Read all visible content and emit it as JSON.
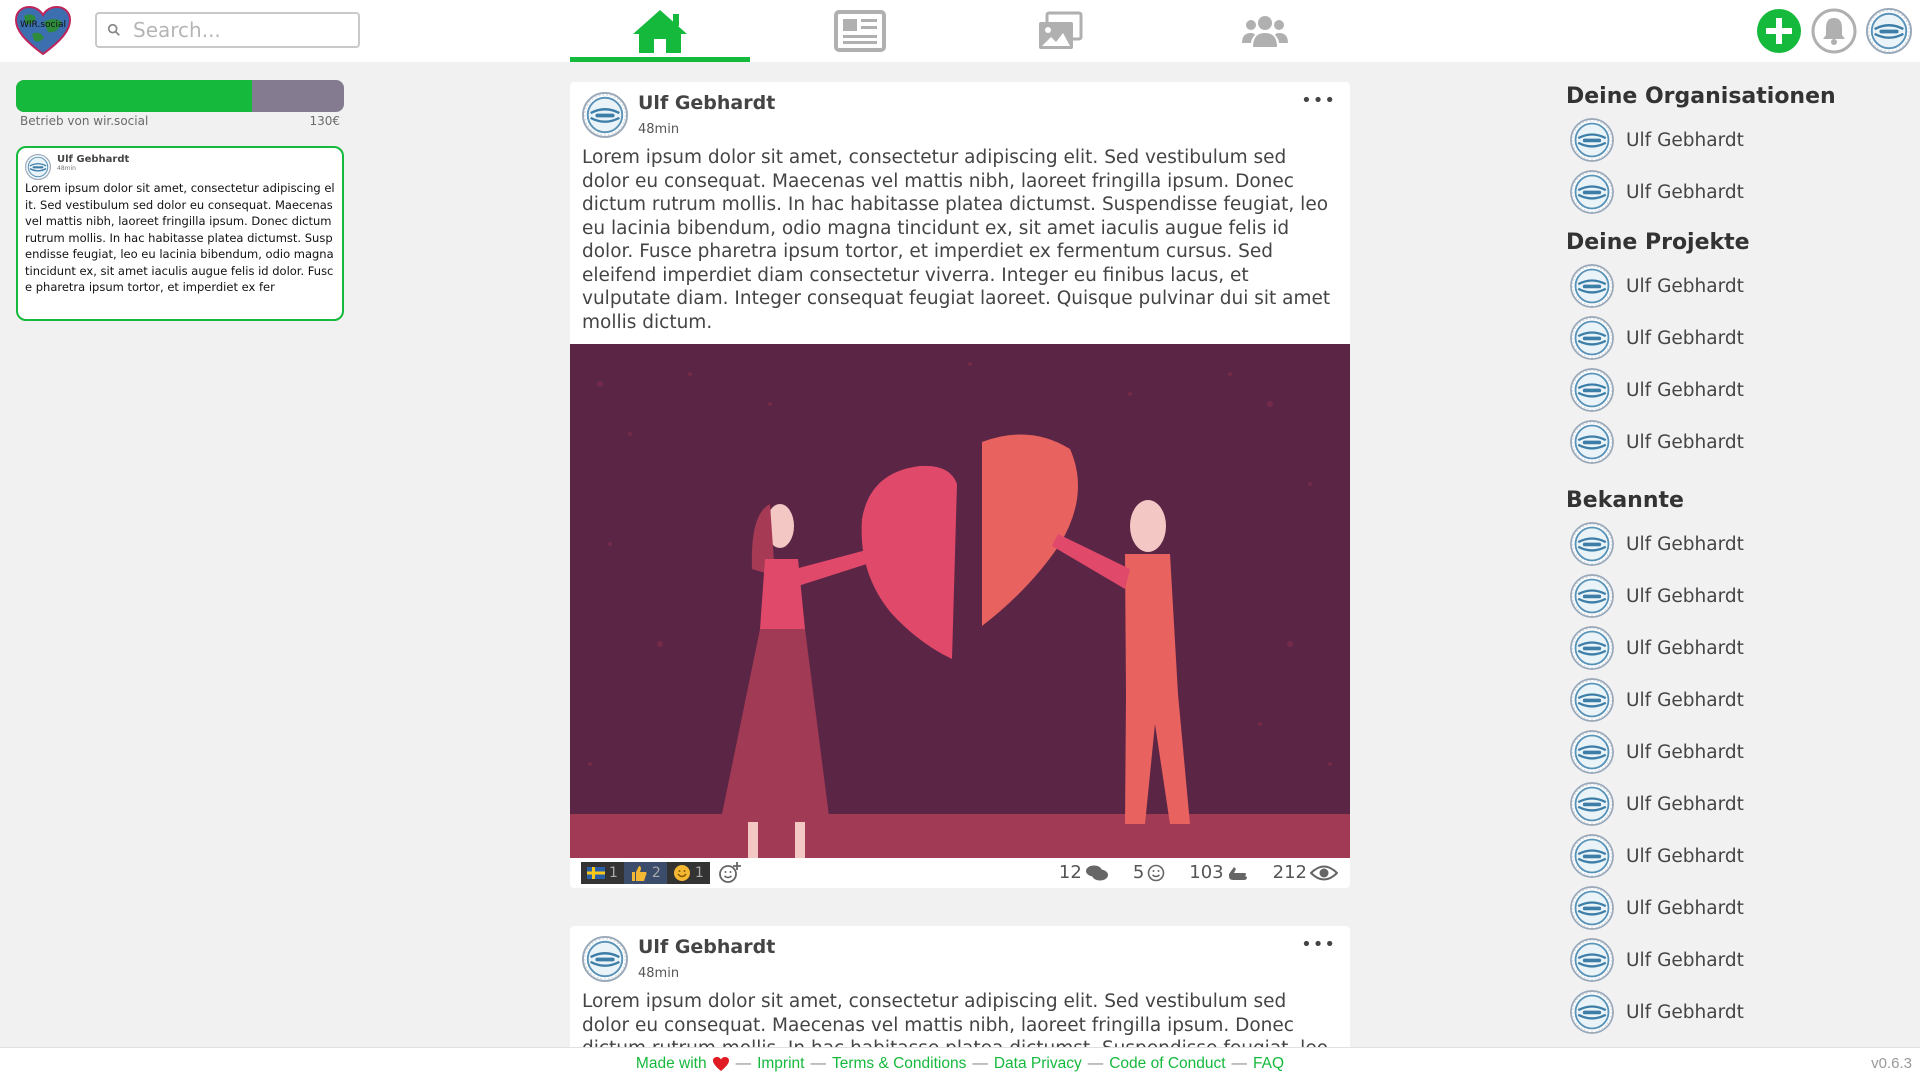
{
  "header": {
    "logo_text": "WIR.social",
    "search_placeholder": "Search...",
    "tabs": [
      {
        "icon": "home-icon",
        "active": true
      },
      {
        "icon": "newspaper-icon",
        "active": false
      },
      {
        "icon": "images-icon",
        "active": false
      },
      {
        "icon": "users-icon",
        "active": false
      }
    ],
    "accent_color": "#15b93c"
  },
  "funding": {
    "label": "Betrieb von wir.social",
    "amount": "130€",
    "progress": 0.72
  },
  "mini_post": {
    "author": "Ulf Gebhardt",
    "time": "48min",
    "text": "Lorem ipsum dolor sit amet, consectetur adipiscing elit. Sed vestibulum sed dolor eu consequat. Maecenas vel mattis nibh, laoreet fringilla ipsum. Donec dictum rutrum mollis. In hac habitasse platea dictumst. Suspendisse feugiat, leo eu lacinia bibendum, odio magna tincidunt ex, sit amet iaculis augue felis id dolor. Fusce pharetra ipsum tortor, et imperdiet ex fer"
  },
  "posts": [
    {
      "author": "Ulf Gebhardt",
      "time": "48min",
      "menu": "•••",
      "text": "Lorem ipsum dolor sit amet, consectetur adipiscing elit. Sed vestibulum sed dolor eu consequat. Maecenas vel mattis nibh, laoreet fringilla ipsum. Donec dictum rutrum mollis. In hac habitasse platea dictumst. Suspendisse feugiat, leo eu lacinia bibendum, odio magna tincidunt ex, sit amet iaculis augue felis id dolor. Fusce pharetra ipsum tortor, et imperdiet ex fermentum cursus. Sed eleifend imperdiet diam consectetur viverra. Integer eu finibus lacus, et vulputate diam. Integer consequat feugiat laoreet. Quisque pulvinar dui sit amet mollis dictum.",
      "reactions": [
        {
          "icon": "swedish-flag-icon",
          "count": "1"
        },
        {
          "icon": "thumbs-up-icon",
          "count": "2"
        },
        {
          "icon": "smiling-face-icon",
          "count": "1"
        }
      ],
      "stats": {
        "comments": "12",
        "smiles": "5",
        "shouts": "103",
        "views": "212"
      }
    },
    {
      "author": "Ulf Gebhardt",
      "time": "48min",
      "menu": "•••",
      "text": "Lorem ipsum dolor sit amet, consectetur adipiscing elit. Sed vestibulum sed dolor eu consequat. Maecenas vel mattis nibh, laoreet fringilla ipsum. Donec dictum rutrum mollis. In hac habitasse platea dictumst. Suspendisse feugiat, leo"
    }
  ],
  "sidebar": {
    "organisations_title": "Deine Organisationen",
    "organisations": [
      "Ulf Gebhardt",
      "Ulf Gebhardt"
    ],
    "projects_title": "Deine Projekte",
    "projects": [
      "Ulf Gebhardt",
      "Ulf Gebhardt",
      "Ulf Gebhardt",
      "Ulf Gebhardt"
    ],
    "friends_title": "Bekannte",
    "friends": [
      "Ulf Gebhardt",
      "Ulf Gebhardt",
      "Ulf Gebhardt",
      "Ulf Gebhardt",
      "Ulf Gebhardt",
      "Ulf Gebhardt",
      "Ulf Gebhardt",
      "Ulf Gebhardt",
      "Ulf Gebhardt",
      "Ulf Gebhardt"
    ]
  },
  "footer": {
    "made_with": "Made with",
    "links": [
      "Imprint",
      "Terms & Conditions",
      "Data Privacy",
      "Code of Conduct",
      "FAQ"
    ],
    "version": "v0.6.3"
  }
}
